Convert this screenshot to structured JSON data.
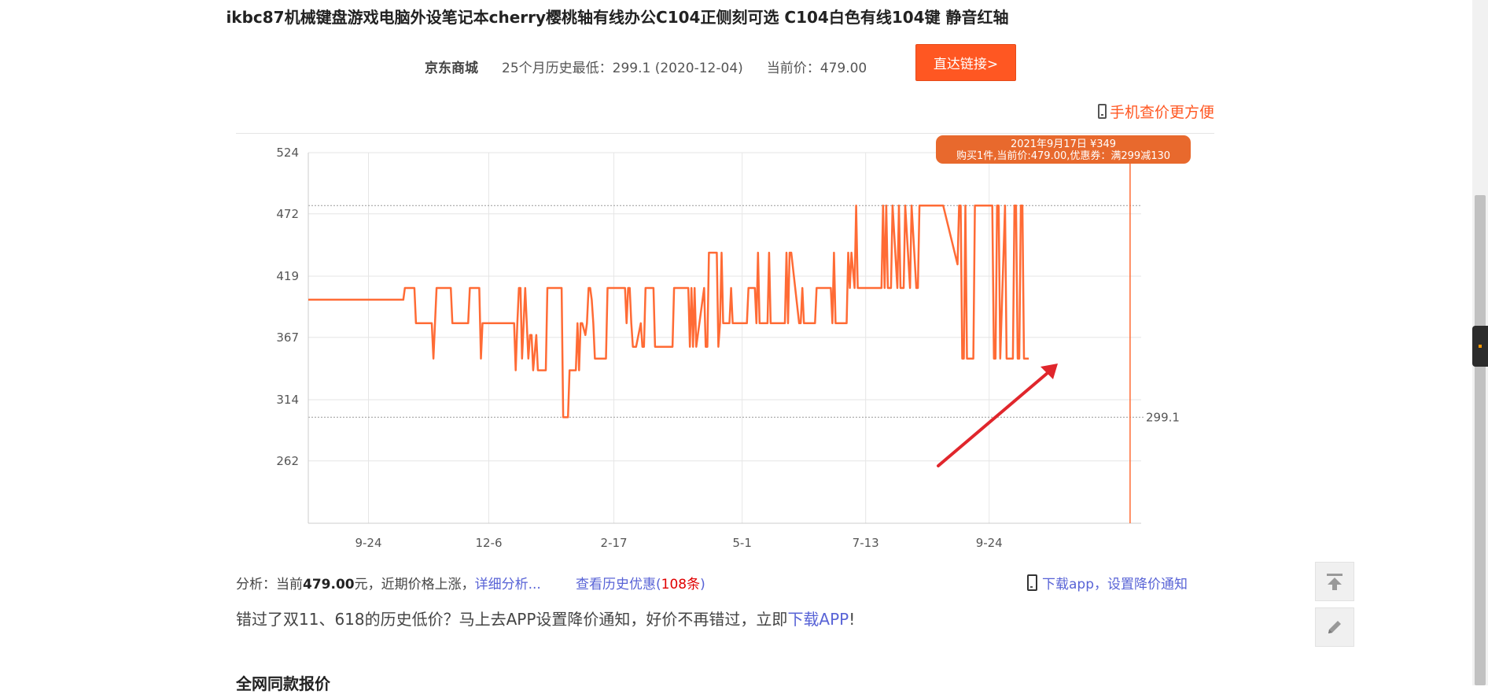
{
  "product_title": "ikbc87机械键盘游戏电脑外设笔记本cherry樱桃轴有线办公C104正侧刻可选 C104白色有线104键 静音红轴",
  "info": {
    "store": "京东商城",
    "history_low": "25个月历史最低：299.1 (2020-12-04)",
    "current_price": "当前价：479.00",
    "go_button": "直达链接>"
  },
  "mobile_link": "手机查价更方便",
  "analysis": {
    "prefix": "分析：当前",
    "price": "479.00",
    "suffix": "元，近期价格上涨，",
    "detail_link": "详细分析...",
    "history_deals": "查看历史优惠(",
    "history_count": "108条",
    "history_close": ")",
    "app_notify": "下载app，设置降价通知"
  },
  "promo": {
    "text": "错过了双11、618的历史低价？马上去APP设置降价通知，好价不再错过，立即",
    "link": "下载APP",
    "end": "!"
  },
  "section_title": "全网同款报价",
  "colors": {
    "line": "#ff6b35",
    "accent": "#ff5722",
    "link": "#5863d6",
    "tooltip": "#e8692d",
    "arrow": "#e0262c"
  },
  "chart_data": {
    "type": "line",
    "x_tick_labels": [
      "9-24",
      "12-6",
      "2-17",
      "5-1",
      "7-13",
      "9-24"
    ],
    "y_ticks": [
      262,
      314,
      367,
      419,
      472,
      524
    ],
    "ylim": [
      209,
      524
    ],
    "grid": true,
    "reference_lines": [
      {
        "value": 479,
        "label": ""
      },
      {
        "value": 299.1,
        "label": "299.1"
      }
    ],
    "tooltip": {
      "line1": "2021年9月17日 ¥349",
      "line2": "购买1件,当前价:479.00,优惠券：满299减130"
    },
    "series": [
      {
        "x_days": [
          0,
          60,
          61,
          67,
          68,
          78,
          79,
          80,
          81,
          90,
          91,
          101,
          102,
          108,
          109,
          110,
          111,
          130,
          131,
          132,
          133,
          134,
          135,
          136,
          137,
          139,
          140,
          141,
          142,
          144,
          145,
          146,
          147,
          150,
          151,
          160,
          161,
          162,
          163,
          164,
          165,
          166,
          167,
          168,
          169,
          170,
          171,
          172,
          173,
          175,
          176,
          177,
          178,
          179,
          180,
          181,
          182,
          188,
          189,
          200,
          201,
          202,
          203,
          204,
          205,
          206,
          207,
          210,
          211,
          212,
          213,
          218,
          219,
          230,
          231,
          240,
          241,
          242,
          243,
          244,
          245,
          250,
          251,
          252,
          253,
          258,
          259,
          260,
          261,
          262,
          263,
          266,
          267,
          268,
          269,
          277,
          278,
          282,
          283,
          284,
          285,
          290,
          291,
          292,
          293,
          300,
          301,
          302,
          303,
          304,
          305,
          310,
          311,
          312,
          313,
          320,
          321,
          330,
          331,
          332,
          333,
          340,
          341,
          342,
          343,
          345,
          346,
          347,
          348,
          355,
          356,
          357,
          358,
          362,
          363,
          364,
          365,
          366,
          367,
          368,
          369,
          372,
          373,
          374,
          375,
          376,
          377,
          380,
          381,
          384,
          385,
          386,
          387,
          388,
          389,
          400,
          401,
          410,
          411,
          412,
          413,
          414,
          415,
          416,
          417,
          420,
          421,
          430,
          431,
          432,
          433,
          434,
          435,
          436,
          437,
          440,
          441,
          442,
          443,
          445,
          446,
          447,
          448,
          449,
          450,
          451,
          452,
          455,
          456,
          458,
          459,
          460,
          461,
          470,
          471,
          472,
          473,
          474,
          475,
          476,
          477,
          478,
          479,
          480,
          481,
          482,
          483,
          484,
          485,
          490,
          491,
          492,
          493,
          494,
          495,
          500,
          501,
          502,
          503,
          506,
          507,
          508,
          509,
          510,
          511,
          513,
          514,
          515,
          516,
          518,
          519,
          520,
          521,
          524,
          525,
          526
        ],
        "values": [
          399,
          399,
          409,
          409,
          379,
          379,
          349,
          379,
          409,
          409,
          379,
          379,
          409,
          409,
          349,
          379,
          379,
          379,
          339,
          379,
          409,
          409,
          349,
          379,
          409,
          349,
          369,
          369,
          339,
          369,
          339,
          339,
          339,
          339,
          409,
          409,
          299.1,
          299.1,
          299.1,
          299.1,
          339,
          339,
          339,
          339,
          339,
          379,
          339,
          379,
          379,
          369,
          379,
          409,
          409,
          399,
          379,
          349,
          349,
          349,
          409,
          409,
          379,
          409,
          409,
          379,
          359,
          359,
          359,
          379,
          359,
          359,
          409,
          409,
          359,
          359,
          409,
          409,
          359,
          409,
          359,
          409,
          359,
          409,
          359,
          359,
          439,
          439,
          359,
          379,
          439,
          379,
          379,
          379,
          409,
          379,
          379,
          379,
          409,
          409,
          379,
          439,
          379,
          379,
          439,
          379,
          379,
          379,
          379,
          439,
          379,
          439,
          439,
          379,
          379,
          409,
          379,
          379,
          409,
          409,
          379,
          439,
          379,
          379,
          439,
          409,
          439,
          409,
          479,
          409,
          409,
          409,
          409,
          409,
          409,
          409,
          479,
          409,
          479,
          409,
          409,
          409,
          479,
          409,
          479,
          409,
          409,
          409,
          479,
          409,
          479,
          409,
          409,
          479,
          479,
          479,
          479,
          479,
          479,
          429,
          479,
          479,
          349,
          349,
          479,
          349,
          349,
          349,
          479,
          479,
          479,
          479,
          349,
          349,
          479,
          479,
          349,
          479,
          349,
          349,
          349,
          349,
          479,
          479,
          349,
          349,
          479,
          479,
          349,
          349
        ],
        "name": ""
      }
    ]
  }
}
